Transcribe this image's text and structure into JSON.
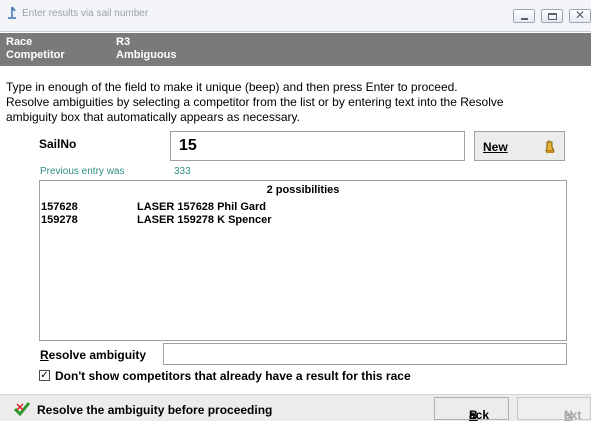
{
  "window": {
    "title": "Enter results via sail number"
  },
  "info": {
    "race_label": "Race",
    "race_value": "R3",
    "competitor_label": "Competitor",
    "competitor_value": "Ambiguous"
  },
  "instructions": {
    "line1": "Type in enough of the field to make it unique (beep) and then press Enter to proceed.",
    "line2": "Resolve ambiguities by selecting a competitor from the list or by entering text into the Resolve",
    "line3": "ambiguity box that automatically appears as necessary."
  },
  "sail_entry": {
    "label": "SailNo",
    "value": "15",
    "new_button": "New"
  },
  "previous": {
    "label": "Previous entry was",
    "value": "333"
  },
  "possibilities": {
    "header": "2 possibilities",
    "items": [
      {
        "sail": "157628",
        "description": "LASER 157628 Phil Gard"
      },
      {
        "sail": "159278",
        "description": "LASER 159278 K Spencer"
      }
    ]
  },
  "resolve": {
    "label_first": "R",
    "label_rest": "esolve ambiguity",
    "value": ""
  },
  "filter": {
    "checked": true,
    "label": "Don't show competitors that already have a result for this race"
  },
  "status": {
    "message": "Resolve the ambiguity before proceeding",
    "back_first": "B",
    "back_rest": "ack",
    "next_first": "N",
    "next_rest": "ext"
  }
}
